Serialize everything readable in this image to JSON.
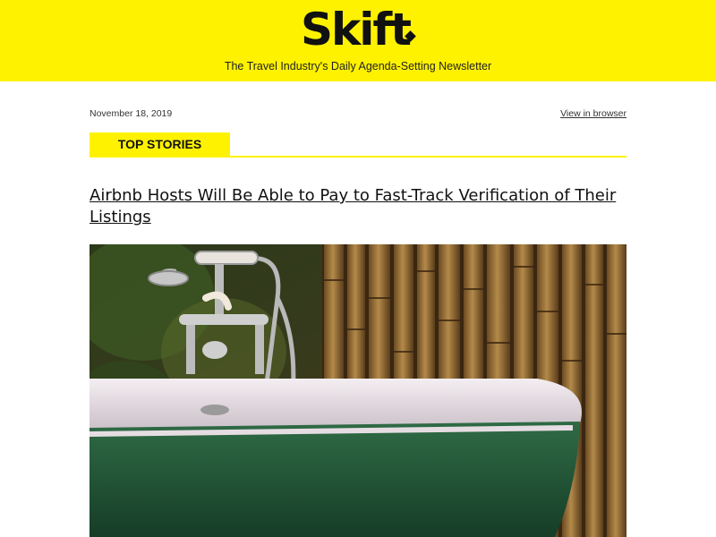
{
  "header": {
    "logo_text": "Skift",
    "tagline": "The Travel Industry's Daily Agenda-Setting Newsletter",
    "background_color": "#fff200"
  },
  "meta": {
    "date": "November 18, 2019",
    "view_in_browser": "View in browser"
  },
  "section": {
    "label": "TOP STORIES",
    "accent_color": "#fff200"
  },
  "story": {
    "headline": "Airbnb Hosts Will Be Able to Pay to Fast-Track Verification of Their Listings",
    "image_icon": "clawfoot-bathtub-photo"
  }
}
